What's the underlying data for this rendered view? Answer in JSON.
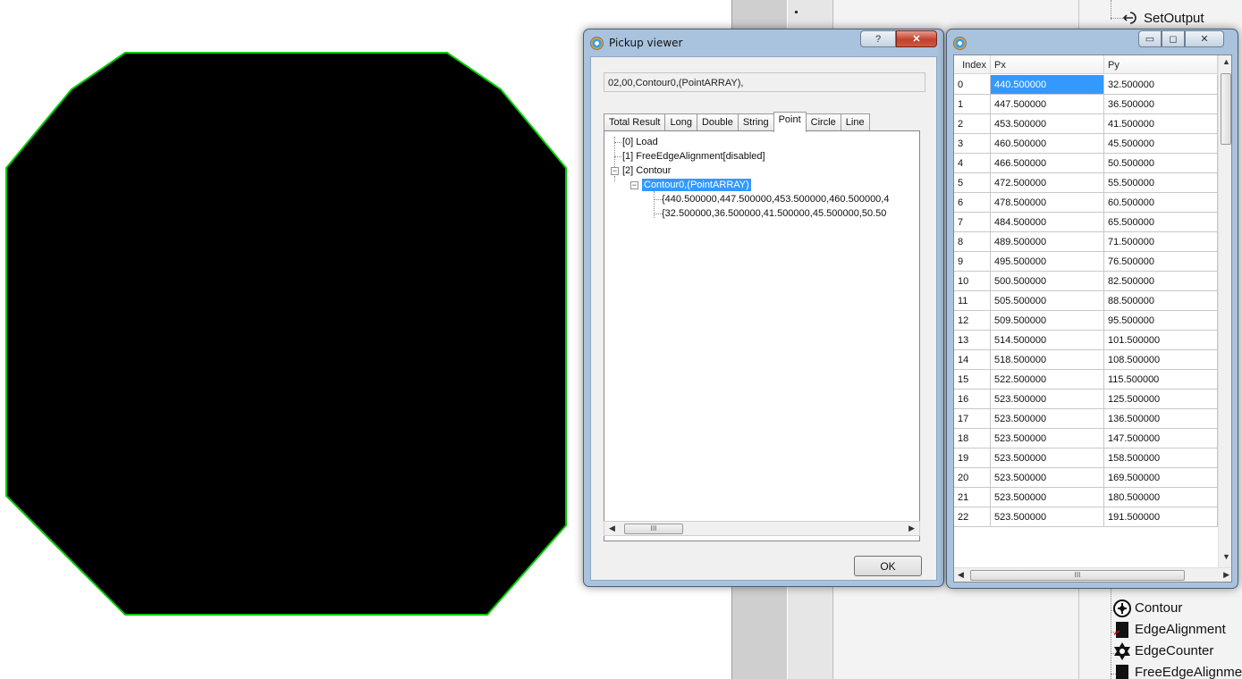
{
  "pickup_viewer": {
    "title": "Pickup viewer",
    "help_icon": "question-icon",
    "path": "02,00,Contour0,(PointARRAY),",
    "tabs": [
      "Total Result",
      "Long",
      "Double",
      "String",
      "Point",
      "Circle",
      "Line"
    ],
    "active_tab": "Point",
    "tree": {
      "item0": "[0] Load",
      "item1": "[1] FreeEdgeAlignment[disabled]",
      "item2": "[2] Contour",
      "item2_child": "Contour0,(PointARRAY)",
      "x_values": "{440.500000,447.500000,453.500000,460.500000,4",
      "y_values": "{32.500000,36.500000,41.500000,45.500000,50.50"
    },
    "scroll_grip": "III",
    "ok_label": "OK"
  },
  "grid_window": {
    "columns": [
      "Index",
      "Px",
      "Py"
    ],
    "rows": [
      [
        "0",
        "440.500000",
        "32.500000"
      ],
      [
        "1",
        "447.500000",
        "36.500000"
      ],
      [
        "2",
        "453.500000",
        "41.500000"
      ],
      [
        "3",
        "460.500000",
        "45.500000"
      ],
      [
        "4",
        "466.500000",
        "50.500000"
      ],
      [
        "5",
        "472.500000",
        "55.500000"
      ],
      [
        "6",
        "478.500000",
        "60.500000"
      ],
      [
        "7",
        "484.500000",
        "65.500000"
      ],
      [
        "8",
        "489.500000",
        "71.500000"
      ],
      [
        "9",
        "495.500000",
        "76.500000"
      ],
      [
        "10",
        "500.500000",
        "82.500000"
      ],
      [
        "11",
        "505.500000",
        "88.500000"
      ],
      [
        "12",
        "509.500000",
        "95.500000"
      ],
      [
        "13",
        "514.500000",
        "101.500000"
      ],
      [
        "14",
        "518.500000",
        "108.500000"
      ],
      [
        "15",
        "522.500000",
        "115.500000"
      ],
      [
        "16",
        "523.500000",
        "125.500000"
      ],
      [
        "17",
        "523.500000",
        "136.500000"
      ],
      [
        "18",
        "523.500000",
        "147.500000"
      ],
      [
        "19",
        "523.500000",
        "158.500000"
      ],
      [
        "20",
        "523.500000",
        "169.500000"
      ],
      [
        "21",
        "523.500000",
        "180.500000"
      ],
      [
        "22",
        "523.500000",
        "191.500000"
      ]
    ],
    "selected_row": 0,
    "scroll_grip": "III"
  },
  "background_tree": {
    "top_item": "SetOutput",
    "items": [
      "Contour",
      "EdgeAlignment",
      "EdgeCounter",
      "FreeEdgeAlignment"
    ]
  },
  "colors": {
    "shape_fill": "#000000",
    "shape_edge": "#00cc00",
    "selection": "#3399ff",
    "window_frame": "#a9c3de"
  }
}
